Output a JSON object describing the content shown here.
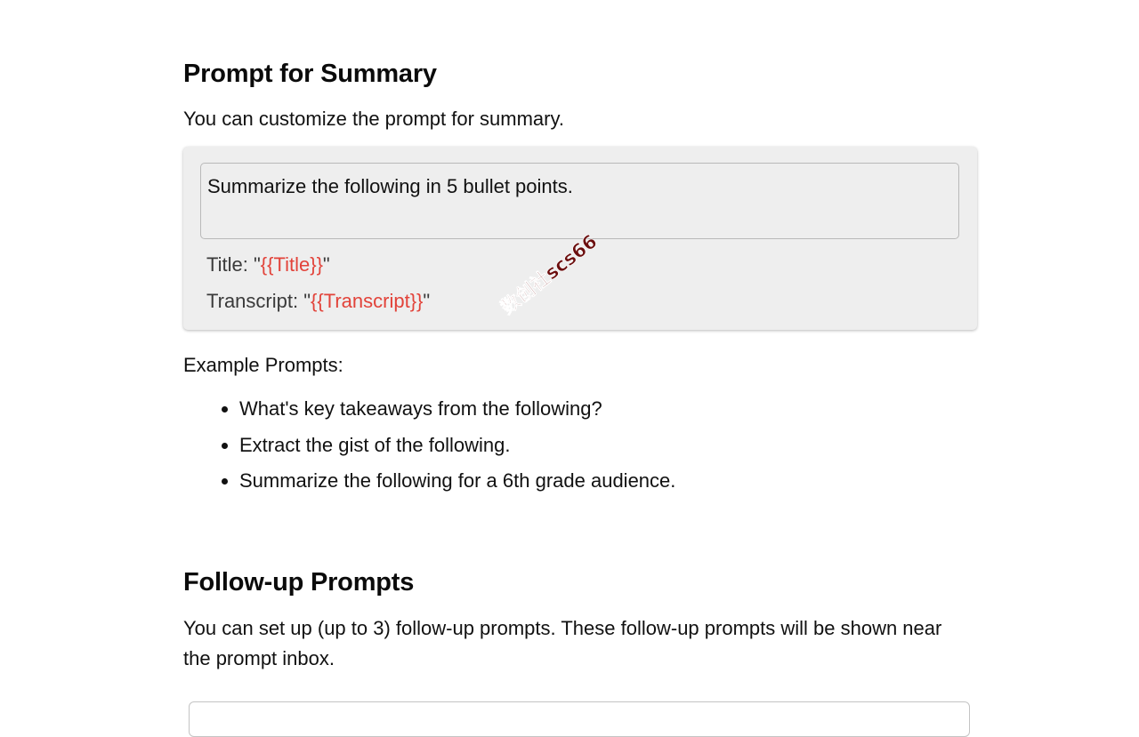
{
  "summary_section": {
    "title": "Prompt for Summary",
    "description": "You can customize the prompt for summary.",
    "prompt_value": "Summarize the following in 5 bullet points.",
    "title_label_prefix": "Title: \"",
    "title_token": "{{Title}}",
    "title_label_suffix": "\"",
    "transcript_label_prefix": "Transcript: \"",
    "transcript_token": "{{Transcript}}",
    "transcript_label_suffix": "\"",
    "examples_label": "Example Prompts:",
    "examples": [
      "What's key takeaways from the following?",
      "Extract the gist of the following.",
      "Summarize the following for a 6th grade audience."
    ]
  },
  "followup_section": {
    "title": "Follow-up Prompts",
    "description": "You can set up (up to 3) follow-up prompts. These follow-up prompts will be shown near the prompt inbox."
  },
  "watermark_text": "数创社scs66",
  "colors": {
    "token": "#e2433a",
    "card_background": "#eeeeee"
  }
}
